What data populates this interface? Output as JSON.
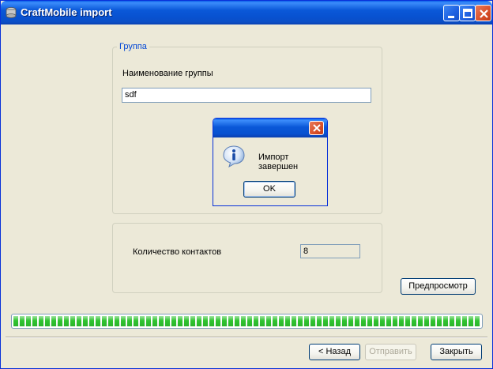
{
  "window": {
    "title": "CraftMobile import"
  },
  "group": {
    "legend": "Группа",
    "name_label": "Наименование группы",
    "name_value": "sdf"
  },
  "contacts": {
    "count_label": "Количество контактов",
    "count_value": "8"
  },
  "buttons": {
    "preview": "Предпросмотр",
    "back": "< Назад",
    "send": "Отправить",
    "close": "Закрыть"
  },
  "progress": {
    "fraction": 1.0
  },
  "dialog": {
    "message": "Импорт завершен",
    "ok": "OK"
  },
  "colors": {
    "titlebar": "#0a58d8",
    "progress_fill": "#2fc32f",
    "accent_text": "#0046d5"
  }
}
